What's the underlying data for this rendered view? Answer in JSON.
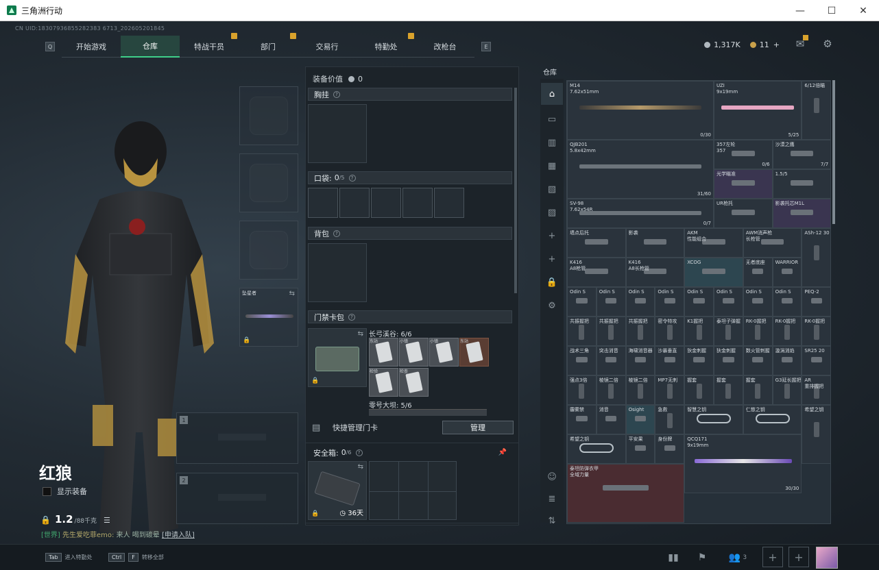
{
  "window": {
    "title": "三角洲行动",
    "minimize": "—",
    "maximize": "☐",
    "close": "✕"
  },
  "uid": "CN UID:18307936855282383 6713_202605201845",
  "nav": {
    "key_left": "Q",
    "key_right": "E",
    "tabs": [
      {
        "label": "开始游戏",
        "active": false,
        "badge": false
      },
      {
        "label": "仓库",
        "active": true,
        "badge": false
      },
      {
        "label": "特战干员",
        "active": false,
        "badge": true
      },
      {
        "label": "部门",
        "active": false,
        "badge": true
      },
      {
        "label": "交易行",
        "active": false,
        "badge": false
      },
      {
        "label": "特勤处",
        "active": false,
        "badge": true
      },
      {
        "label": "改枪台",
        "active": false,
        "badge": false
      }
    ]
  },
  "currency": {
    "coins": "1,317K",
    "gold": "11",
    "plus": "+"
  },
  "operator": {
    "name": "红狼",
    "show_equipment": "显示装备",
    "weight": "1.2",
    "weight_max": "/88千克"
  },
  "weapon_slots": [
    {
      "num": "1"
    },
    {
      "num": "2"
    }
  ],
  "melee": {
    "label": "坠星者"
  },
  "chat": {
    "channel": "[世界]",
    "name": "先生爱吃菲emo:",
    "msg": "来人 喝到碳晕",
    "link": "[申请入队]"
  },
  "equip": {
    "value_label": "装备价值",
    "value": "0",
    "chest_rig": "胸挂",
    "pocket_label": "口袋:",
    "pocket_count": "0",
    "pocket_max": "/5",
    "backpack": "背包",
    "keycard_bag": "门禁卡包",
    "keyset1_label": "长弓溪谷: 6/6",
    "keyset2_label": "零号大坝: 5/6",
    "quick_manage": "快捷管理门卡",
    "manage_btn": "管理",
    "safebox_label": "安全箱:",
    "safebox_count": "0",
    "safebox_max": "/6",
    "safebox_days": "36天",
    "keycards": [
      "东站",
      "小镇",
      "小镇",
      "东站",
      "检验",
      "检查",
      "",
      ""
    ]
  },
  "stash": {
    "label": "仓库",
    "items": [
      {
        "name": "M14\n7.62x51mm",
        "count": "0/30",
        "col": 0,
        "row": 0,
        "w": 5,
        "h": 2,
        "style": "gun gold",
        "bg": ""
      },
      {
        "name": "UZI\n9x19mm",
        "count": "5/25",
        "col": 5,
        "row": 0,
        "w": 3,
        "h": 2,
        "style": "gun pink",
        "bg": ""
      },
      {
        "name": "6/12倍瞄",
        "count": "",
        "col": 8,
        "row": 0,
        "w": 1,
        "h": 2,
        "style": "vert",
        "bg": ""
      },
      {
        "name": "QJB201\n5.8x42mm",
        "count": "31/60",
        "col": 0,
        "row": 2,
        "w": 5,
        "h": 2,
        "style": "gun",
        "bg": ""
      },
      {
        "name": "357左轮\n357",
        "count": "0/6",
        "col": 5,
        "row": 2,
        "w": 2,
        "h": 1,
        "style": "smallitem",
        "bg": ""
      },
      {
        "name": "沙漠之鹰",
        "count": "7/7",
        "col": 7,
        "row": 2,
        "w": 2,
        "h": 1,
        "style": "smallitem",
        "bg": ""
      },
      {
        "name": "光学瞄准",
        "count": "",
        "col": 5,
        "row": 3,
        "w": 2,
        "h": 1,
        "style": "smallitem",
        "bg": "purple"
      },
      {
        "name": "1.5/5",
        "count": "",
        "col": 7,
        "row": 3,
        "w": 2,
        "h": 1,
        "style": "smallitem",
        "bg": ""
      },
      {
        "name": "SV-98\n7.62x54R",
        "count": "0/7",
        "col": 0,
        "row": 4,
        "w": 5,
        "h": 1,
        "style": "gun",
        "bg": ""
      },
      {
        "name": "UR枪托",
        "count": "",
        "col": 5,
        "row": 4,
        "w": 2,
        "h": 1,
        "style": "smallitem",
        "bg": ""
      },
      {
        "name": "影袭托芯M1L",
        "count": "",
        "col": 7,
        "row": 4,
        "w": 2,
        "h": 1,
        "style": "smallitem",
        "bg": "purple"
      },
      {
        "name": "墙点后托",
        "count": "",
        "col": 0,
        "row": 5,
        "w": 2,
        "h": 1,
        "style": "smallitem",
        "bg": ""
      },
      {
        "name": "影袭",
        "count": "",
        "col": 2,
        "row": 5,
        "w": 2,
        "h": 1,
        "style": "smallitem",
        "bg": ""
      },
      {
        "name": "AKM\n性能组合",
        "count": "",
        "col": 4,
        "row": 5,
        "w": 2,
        "h": 1,
        "style": "smallitem",
        "bg": ""
      },
      {
        "name": "AWM消声枪\n长枪管",
        "count": "",
        "col": 6,
        "row": 5,
        "w": 2,
        "h": 1,
        "style": "smallitem",
        "bg": ""
      },
      {
        "name": "ASh-12 30",
        "count": "",
        "col": 8,
        "row": 5,
        "w": 1,
        "h": 2,
        "style": "vert",
        "bg": ""
      },
      {
        "name": "K416\nA8枪管",
        "count": "",
        "col": 0,
        "row": 6,
        "w": 2,
        "h": 1,
        "style": "smallitem",
        "bg": ""
      },
      {
        "name": "K416\nA8长枪管",
        "count": "",
        "col": 2,
        "row": 6,
        "w": 2,
        "h": 1,
        "style": "smallitem",
        "bg": ""
      },
      {
        "name": "XCOG",
        "count": "",
        "col": 4,
        "row": 6,
        "w": 2,
        "h": 1,
        "style": "smallitem",
        "bg": "teal"
      },
      {
        "name": "无者底座",
        "count": "",
        "col": 6,
        "row": 6,
        "w": 1,
        "h": 1,
        "style": "smallitem",
        "bg": ""
      },
      {
        "name": "WARRIOR",
        "count": "",
        "col": 7,
        "row": 6,
        "w": 1,
        "h": 1,
        "style": "smallitem",
        "bg": ""
      },
      {
        "name": "Odin S",
        "count": "",
        "col": 0,
        "row": 7,
        "w": 1,
        "h": 1,
        "style": "smallitem",
        "bg": ""
      },
      {
        "name": "Odin S",
        "count": "",
        "col": 1,
        "row": 7,
        "w": 1,
        "h": 1,
        "style": "smallitem",
        "bg": ""
      },
      {
        "name": "Odin S",
        "count": "",
        "col": 2,
        "row": 7,
        "w": 1,
        "h": 1,
        "style": "smallitem",
        "bg": ""
      },
      {
        "name": "Odin S",
        "count": "",
        "col": 3,
        "row": 7,
        "w": 1,
        "h": 1,
        "style": "smallitem",
        "bg": ""
      },
      {
        "name": "Odin S",
        "count": "",
        "col": 4,
        "row": 7,
        "w": 1,
        "h": 1,
        "style": "smallitem",
        "bg": ""
      },
      {
        "name": "Odin S",
        "count": "",
        "col": 5,
        "row": 7,
        "w": 1,
        "h": 1,
        "style": "smallitem",
        "bg": ""
      },
      {
        "name": "Odin S",
        "count": "",
        "col": 6,
        "row": 7,
        "w": 1,
        "h": 1,
        "style": "smallitem",
        "bg": ""
      },
      {
        "name": "Odin S",
        "count": "",
        "col": 7,
        "row": 7,
        "w": 1,
        "h": 1,
        "style": "smallitem",
        "bg": ""
      },
      {
        "name": "PEQ-2",
        "count": "",
        "col": 8,
        "row": 7,
        "w": 1,
        "h": 1,
        "style": "smallitem",
        "bg": ""
      },
      {
        "name": "共振握把",
        "count": "",
        "col": 0,
        "row": 8,
        "w": 1,
        "h": 1,
        "style": "vert",
        "bg": ""
      },
      {
        "name": "共振握把",
        "count": "",
        "col": 1,
        "row": 8,
        "w": 1,
        "h": 1,
        "style": "vert",
        "bg": ""
      },
      {
        "name": "共振握把",
        "count": "",
        "col": 2,
        "row": 8,
        "w": 1,
        "h": 1,
        "style": "vert",
        "bg": ""
      },
      {
        "name": "密令特攻",
        "count": "",
        "col": 3,
        "row": 8,
        "w": 1,
        "h": 1,
        "style": "vert",
        "bg": ""
      },
      {
        "name": "K1握把",
        "count": "",
        "col": 4,
        "row": 8,
        "w": 1,
        "h": 1,
        "style": "vert",
        "bg": ""
      },
      {
        "name": "泰坦子弹握",
        "count": "",
        "col": 5,
        "row": 8,
        "w": 1,
        "h": 1,
        "style": "vert",
        "bg": ""
      },
      {
        "name": "RK-0握把",
        "count": "",
        "col": 6,
        "row": 8,
        "w": 1,
        "h": 1,
        "style": "vert",
        "bg": ""
      },
      {
        "name": "RK-0握把",
        "count": "",
        "col": 7,
        "row": 8,
        "w": 1,
        "h": 1,
        "style": "vert",
        "bg": ""
      },
      {
        "name": "RK-0握把",
        "count": "",
        "col": 8,
        "row": 8,
        "w": 1,
        "h": 1,
        "style": "vert",
        "bg": ""
      },
      {
        "name": "战术三角",
        "count": "",
        "col": 0,
        "row": 9,
        "w": 1,
        "h": 1,
        "style": "smallitem",
        "bg": ""
      },
      {
        "name": "突击消音",
        "count": "",
        "col": 1,
        "row": 9,
        "w": 1,
        "h": 1,
        "style": "smallitem",
        "bg": ""
      },
      {
        "name": "海啸消音器",
        "count": "",
        "col": 2,
        "row": 9,
        "w": 1,
        "h": 1,
        "style": "smallitem",
        "bg": ""
      },
      {
        "name": "沙暴垂直",
        "count": "",
        "col": 3,
        "row": 9,
        "w": 1,
        "h": 1,
        "style": "smallitem",
        "bg": ""
      },
      {
        "name": "狄金刺握",
        "count": "",
        "col": 4,
        "row": 9,
        "w": 1,
        "h": 1,
        "style": "smallitem",
        "bg": ""
      },
      {
        "name": "狄金刺握",
        "count": "",
        "col": 5,
        "row": 9,
        "w": 1,
        "h": 1,
        "style": "smallitem",
        "bg": ""
      },
      {
        "name": "数火管刺握",
        "count": "",
        "col": 6,
        "row": 9,
        "w": 1,
        "h": 1,
        "style": "smallitem",
        "bg": ""
      },
      {
        "name": "漩涡消焰",
        "count": "",
        "col": 7,
        "row": 9,
        "w": 1,
        "h": 1,
        "style": "smallitem",
        "bg": ""
      },
      {
        "name": "SR25 20",
        "count": "",
        "col": 8,
        "row": 9,
        "w": 1,
        "h": 1,
        "style": "smallitem",
        "bg": ""
      },
      {
        "name": "强点3倍",
        "count": "",
        "col": 0,
        "row": 10,
        "w": 1,
        "h": 1,
        "style": "vert",
        "bg": ""
      },
      {
        "name": "棱镜二倍",
        "count": "",
        "col": 1,
        "row": 10,
        "w": 1,
        "h": 1,
        "style": "vert",
        "bg": ""
      },
      {
        "name": "棱镜二倍",
        "count": "",
        "col": 2,
        "row": 10,
        "w": 1,
        "h": 1,
        "style": "vert",
        "bg": ""
      },
      {
        "name": "MP7无刺",
        "count": "",
        "col": 3,
        "row": 10,
        "w": 1,
        "h": 1,
        "style": "vert",
        "bg": ""
      },
      {
        "name": "握套",
        "count": "",
        "col": 4,
        "row": 10,
        "w": 1,
        "h": 1,
        "style": "vert",
        "bg": ""
      },
      {
        "name": "握套",
        "count": "",
        "col": 5,
        "row": 10,
        "w": 1,
        "h": 1,
        "style": "vert",
        "bg": ""
      },
      {
        "name": "握套",
        "count": "",
        "col": 6,
        "row": 10,
        "w": 1,
        "h": 1,
        "style": "vert",
        "bg": ""
      },
      {
        "name": "G3延长握把",
        "count": "",
        "col": 7,
        "row": 10,
        "w": 1,
        "h": 1,
        "style": "vert",
        "bg": ""
      },
      {
        "name": "AR\n重排握把",
        "count": "",
        "col": 8,
        "row": 10,
        "w": 1,
        "h": 1,
        "style": "vert",
        "bg": ""
      },
      {
        "name": "霾雾禁",
        "count": "",
        "col": 0,
        "row": 11,
        "w": 1,
        "h": 1,
        "style": "smallitem",
        "bg": ""
      },
      {
        "name": "消音",
        "count": "",
        "col": 1,
        "row": 11,
        "w": 1,
        "h": 1,
        "style": "smallitem",
        "bg": ""
      },
      {
        "name": "Osight",
        "count": "",
        "col": 2,
        "row": 11,
        "w": 1,
        "h": 1,
        "style": "smallitem",
        "bg": "teal"
      },
      {
        "name": "急救",
        "count": "",
        "col": 3,
        "row": 11,
        "w": 1,
        "h": 1,
        "style": "vert",
        "bg": ""
      },
      {
        "name": "智慧之钥",
        "count": "",
        "col": 4,
        "row": 11,
        "w": 2,
        "h": 1,
        "style": "keyitem",
        "bg": ""
      },
      {
        "name": "仁慈之钥",
        "count": "",
        "col": 6,
        "row": 11,
        "w": 2,
        "h": 1,
        "style": "keyitem",
        "bg": ""
      },
      {
        "name": "希望之钥",
        "count": "",
        "col": 8,
        "row": 11,
        "w": 1,
        "h": 2,
        "style": "vert",
        "bg": ""
      },
      {
        "name": "希望之钥",
        "count": "",
        "col": 0,
        "row": 12,
        "w": 2,
        "h": 1,
        "style": "keyitem",
        "bg": ""
      },
      {
        "name": "平安果",
        "count": "",
        "col": 2,
        "row": 12,
        "w": 1,
        "h": 1,
        "style": "smallitem",
        "bg": ""
      },
      {
        "name": "身份牌",
        "count": "",
        "col": 3,
        "row": 12,
        "w": 1,
        "h": 1,
        "style": "smallitem",
        "bg": ""
      },
      {
        "name": "QCQ171\n9x19mm",
        "count": "30/30",
        "col": 4,
        "row": 12,
        "w": 4,
        "h": 2,
        "style": "gun purple",
        "bg": ""
      },
      {
        "name": "泰坦防弹衣甲\n全域力量",
        "count": "",
        "col": 0,
        "row": 13,
        "w": 4,
        "h": 2,
        "style": "smallitem",
        "bg": "red"
      }
    ]
  },
  "bottom": {
    "tab_key": "Tab",
    "tab_label": "进入特勤处",
    "ctrl_key": "Ctrl",
    "f_key": "F",
    "f_label": "转移全部",
    "squad_count": "3"
  }
}
